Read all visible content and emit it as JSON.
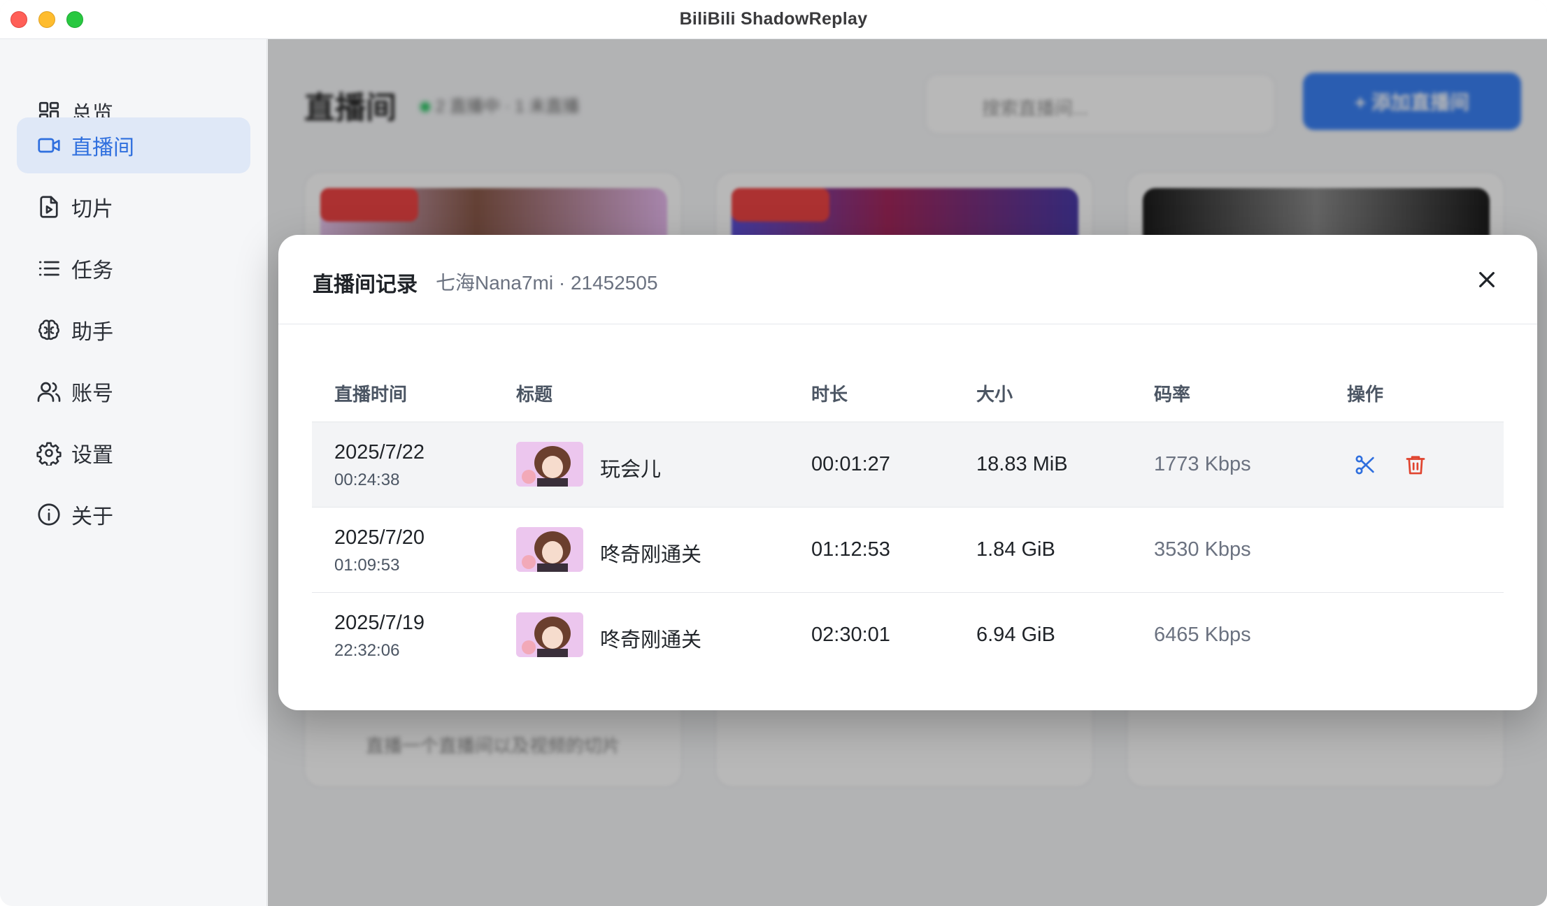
{
  "app": {
    "title": "BiliBili ShadowReplay"
  },
  "sidebar": {
    "items": [
      {
        "label": "总览",
        "icon": "dashboard-icon",
        "active": false
      },
      {
        "label": "直播间",
        "icon": "video-camera-icon",
        "active": true
      },
      {
        "label": "切片",
        "icon": "file-play-icon",
        "active": false
      },
      {
        "label": "任务",
        "icon": "list-icon",
        "active": false
      },
      {
        "label": "助手",
        "icon": "brain-icon",
        "active": false
      },
      {
        "label": "账号",
        "icon": "users-icon",
        "active": false
      },
      {
        "label": "设置",
        "icon": "gear-icon",
        "active": false
      },
      {
        "label": "关于",
        "icon": "info-icon",
        "active": false
      }
    ]
  },
  "modal": {
    "title": "直播间记录",
    "subtitle": "七海Nana7mi · 21452505",
    "columns": [
      "直播时间",
      "标题",
      "时长",
      "大小",
      "码率",
      "操作"
    ],
    "rows": [
      {
        "date": "2025/7/22",
        "time": "00:24:38",
        "title": "玩会儿",
        "duration": "00:01:27",
        "size": "18.83 MiB",
        "bitrate": "1773 Kbps",
        "actions": [
          "scissors-icon",
          "trash-icon"
        ]
      },
      {
        "date": "2025/7/20",
        "time": "01:09:53",
        "title": "咚奇刚通关",
        "duration": "01:12:53",
        "size": "1.84 GiB",
        "bitrate": "3530 Kbps",
        "actions": []
      },
      {
        "date": "2025/7/19",
        "time": "22:32:06",
        "title": "咚奇刚通关",
        "duration": "02:30:01",
        "size": "6.94 GiB",
        "bitrate": "6465 Kbps",
        "actions": []
      }
    ]
  },
  "background": {
    "page_title": "直播间",
    "status": "2 直播中 · 1 未直播",
    "search_placeholder": "搜索直播间...",
    "add_button": "+ 添加直播间",
    "card_text": "直播一个直播间以及视频的切片"
  },
  "colors": {
    "accent": "#2f6fde",
    "danger": "#e0442f",
    "active_nav_bg": "#dfe8f7"
  }
}
